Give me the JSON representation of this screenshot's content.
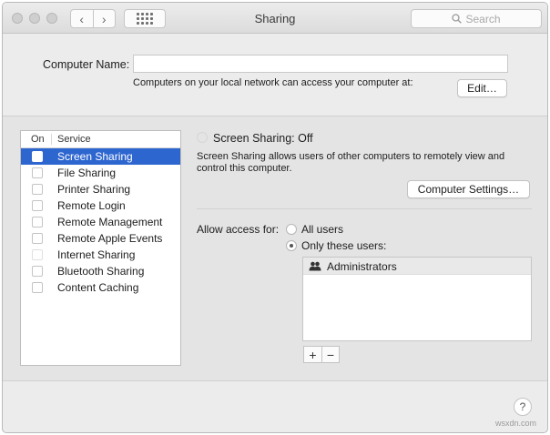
{
  "window": {
    "title": "Sharing",
    "nav_back": "‹",
    "nav_forward": "›",
    "search_placeholder": "Search"
  },
  "computer_name": {
    "label": "Computer Name:",
    "value": "",
    "network_text": "Computers on your local network can access your computer at:",
    "edit_button": "Edit…"
  },
  "service_list": {
    "header_on": "On",
    "header_service": "Service",
    "items": [
      {
        "label": "Screen Sharing",
        "checked": false,
        "selected": true
      },
      {
        "label": "File Sharing",
        "checked": false,
        "selected": false
      },
      {
        "label": "Printer Sharing",
        "checked": false,
        "selected": false
      },
      {
        "label": "Remote Login",
        "checked": false,
        "selected": false
      },
      {
        "label": "Remote Management",
        "checked": false,
        "selected": false
      },
      {
        "label": "Remote Apple Events",
        "checked": false,
        "selected": false
      },
      {
        "label": "Internet Sharing",
        "checked": false,
        "selected": false
      },
      {
        "label": "Bluetooth Sharing",
        "checked": false,
        "selected": false
      },
      {
        "label": "Content Caching",
        "checked": false,
        "selected": false
      }
    ]
  },
  "detail": {
    "status": "Screen Sharing: Off",
    "description": "Screen Sharing allows users of other computers to remotely view and control this computer.",
    "computer_settings_button": "Computer Settings…",
    "allow_access_label": "Allow access for:",
    "option_all_users": "All users",
    "option_only_these": "Only these users:",
    "selected_option": "only_these",
    "users": [
      {
        "name": "Administrators",
        "icon": "group-icon"
      }
    ],
    "add_button": "+",
    "remove_button": "−"
  },
  "help_button": "?",
  "watermark": "wsxdn.com",
  "colors": {
    "selection": "#2e66d0",
    "window_bg": "#ececec"
  }
}
